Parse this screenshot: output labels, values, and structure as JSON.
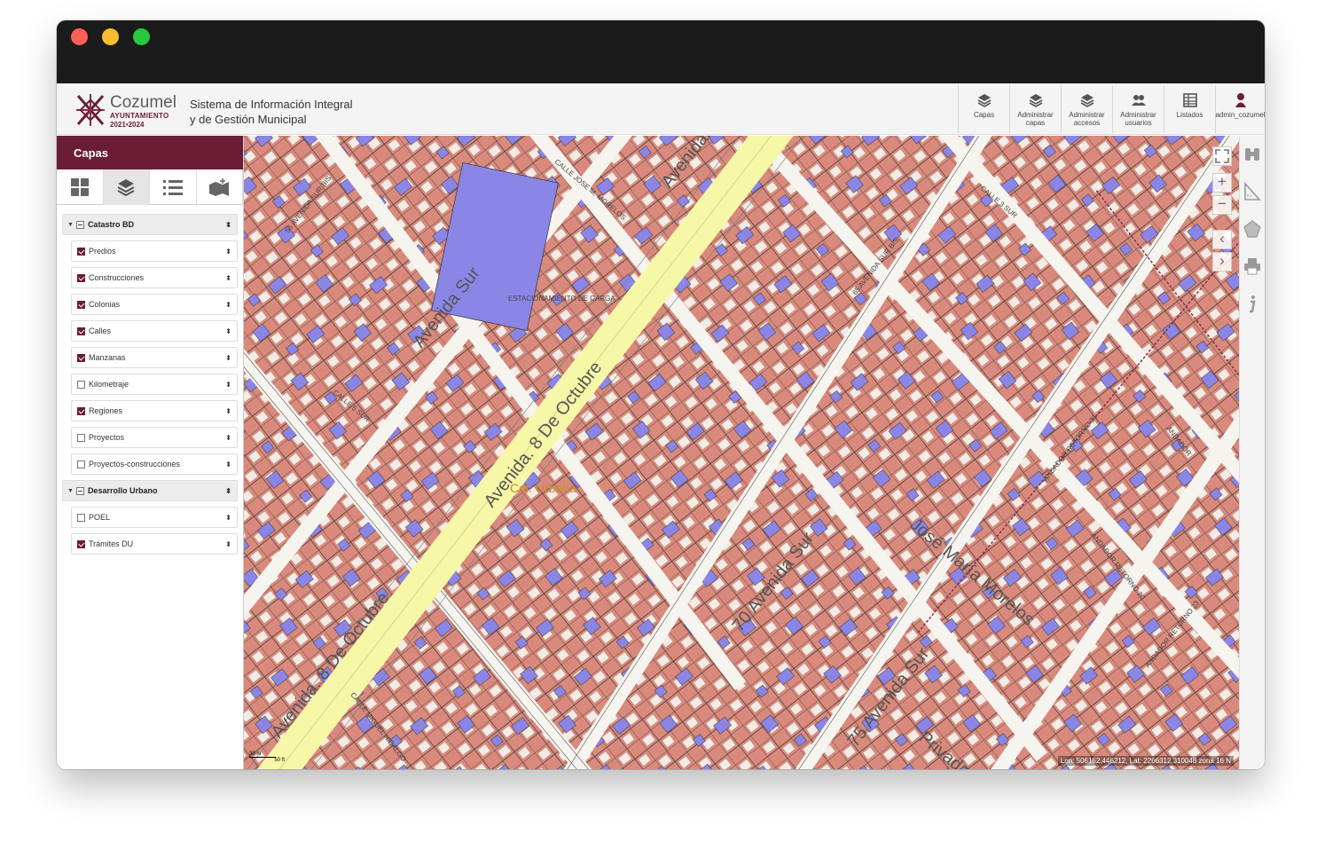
{
  "header": {
    "brand_name": "Cozumel",
    "brand_sub": "AYUNTAMIENTO",
    "brand_years": "2021•2024",
    "system_title_line1": "Sistema de Información Integral",
    "system_title_line2": "y de Gestión Municipal"
  },
  "toolbar": [
    {
      "label": "Capas",
      "icon": "layers-icon"
    },
    {
      "label": "Administrar capas",
      "icon": "layers-icon"
    },
    {
      "label": "Administrar accesos",
      "icon": "layers-icon"
    },
    {
      "label": "Administrar usuarios",
      "icon": "users-icon"
    },
    {
      "label": "Listados",
      "icon": "table-icon"
    },
    {
      "label": "admin_cozumel",
      "icon": "user-icon"
    }
  ],
  "sidebar": {
    "title": "Capas",
    "tabs": [
      "grid-icon",
      "layers-icon",
      "list-icon",
      "map-add-icon"
    ],
    "groups": [
      {
        "label": "Catastro BD",
        "layers": [
          {
            "label": "Predios",
            "checked": true
          },
          {
            "label": "Construcciones",
            "checked": true
          },
          {
            "label": "Colonias",
            "checked": true
          },
          {
            "label": "Calles",
            "checked": true
          },
          {
            "label": "Manzanas",
            "checked": true
          },
          {
            "label": "Kilometraje",
            "checked": false
          },
          {
            "label": "Regiones",
            "checked": true
          },
          {
            "label": "Proyectos",
            "checked": false
          },
          {
            "label": "Proyectos-construcciones",
            "checked": false
          }
        ]
      },
      {
        "label": "Desarrollo Urbano",
        "layers": [
          {
            "label": "POEL",
            "checked": false
          },
          {
            "label": "Trámites DU",
            "checked": true
          }
        ]
      }
    ]
  },
  "map": {
    "streets": [
      "Avenida. 8 De Octubre",
      "Avenida Sur",
      "José María Morelos",
      "70 Avenida Sur",
      "75 Avenida Sur",
      "Privada",
      "Col. Urbana"
    ],
    "small_streets": [
      "CALLE JOSE M. MORELOS",
      "CALLE 3 SUR",
      "CALLE 5 SUR",
      "65 AVENIDA SUR BIS",
      "55 AVENIDA SUR BIS",
      "CALLE MIGUEL HIDALGO",
      "ANDADOR RETORNO 21",
      "ANDADOR RETORNO 20",
      "ANDADOR RETORNO 23",
      "ANDADOR",
      "ESTACIONAMIENTO DE CARGA"
    ],
    "coords": "Lon: 506162.446212, Lat: 2266312.310048 zona 16 N",
    "scale_top": "30 m",
    "scale_bottom": "50 ft",
    "colors": {
      "lot": "#d98a7c",
      "building": "#8b86e6",
      "road": "#f7f7a8",
      "block": "#f2f0ea",
      "accent": "#6b1d35"
    }
  },
  "rightbar": [
    "binoculars-icon",
    "ruler-icon",
    "polygon-icon",
    "print-icon",
    "info-icon"
  ]
}
